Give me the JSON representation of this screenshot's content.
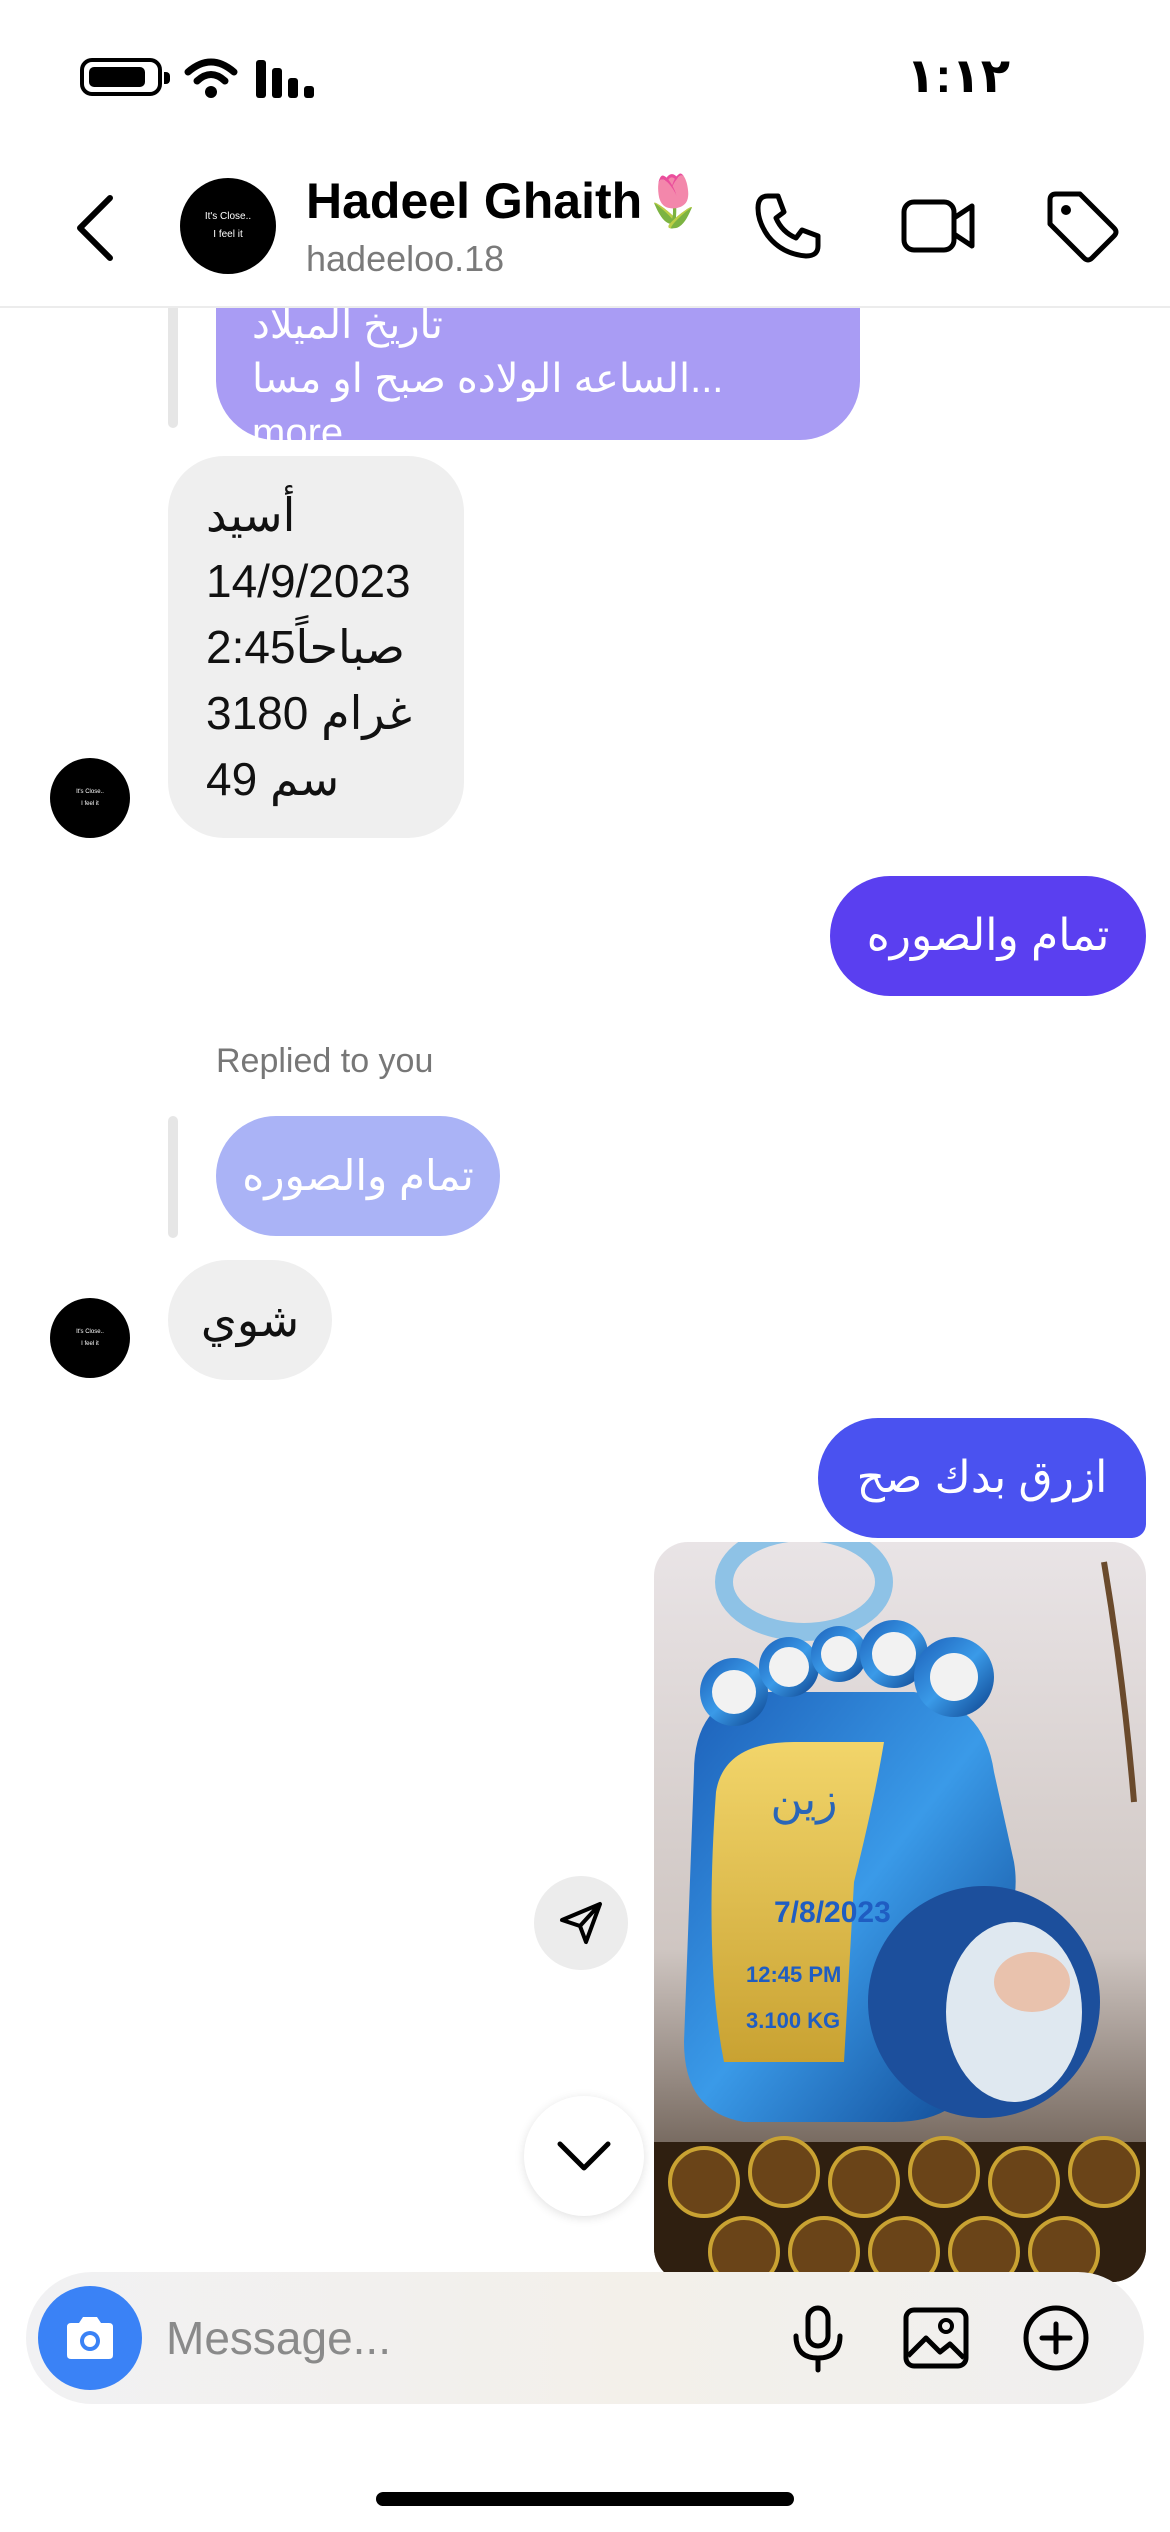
{
  "status_bar": {
    "time": "١:١٢",
    "icons": [
      "battery-icon",
      "wifi-icon",
      "signal-icon"
    ]
  },
  "header": {
    "back_icon": "chevron-left-icon",
    "avatar_text_top": "It's Close..",
    "avatar_text_bottom": "I feel it",
    "contact_name": "Hadeel Ghaith",
    "contact_emoji": "🌷",
    "contact_handle": "hadeeloo.18",
    "actions": [
      "phone-icon",
      "video-camera-icon",
      "tag-icon"
    ]
  },
  "messages": {
    "quoted_top": {
      "line1": "تاريخ الميلاد",
      "line2": "الساعه الولاده صبح او مسا... more"
    },
    "incoming_birth": {
      "lines": [
        "أسيد",
        "14/9/2023",
        "2:45صباحاً",
        "3180 غرام",
        "49 سم"
      ]
    },
    "outgoing_1": "تمام والصوره",
    "replied_label": "Replied to you",
    "quoted_reply": "تمام والصوره",
    "incoming_2": "شوي",
    "outgoing_2": "ازرق بدك صح",
    "photo_texts": {
      "date": "7/8/2023",
      "time": "12:45 PM",
      "weight": "3.100 KG"
    }
  },
  "avatar_small": {
    "top": "It's Close..",
    "bottom": "I feel it"
  },
  "floating": {
    "share_icon": "paper-plane-icon",
    "scroll_down_icon": "chevron-down-icon"
  },
  "composer": {
    "placeholder": "Message...",
    "camera_icon": "camera-icon",
    "mic_icon": "microphone-icon",
    "gallery_icon": "image-icon",
    "plus_icon": "plus-circle-icon"
  },
  "colors": {
    "outgoing_gradient_top": "#6a3cf0",
    "outgoing_gradient_bottom": "#3c5cf0",
    "quote_purple": "#a99cf4",
    "quote_blue": "#aab3f6",
    "incoming_bg": "#efefef",
    "camera_blue": "#3a82f6"
  }
}
